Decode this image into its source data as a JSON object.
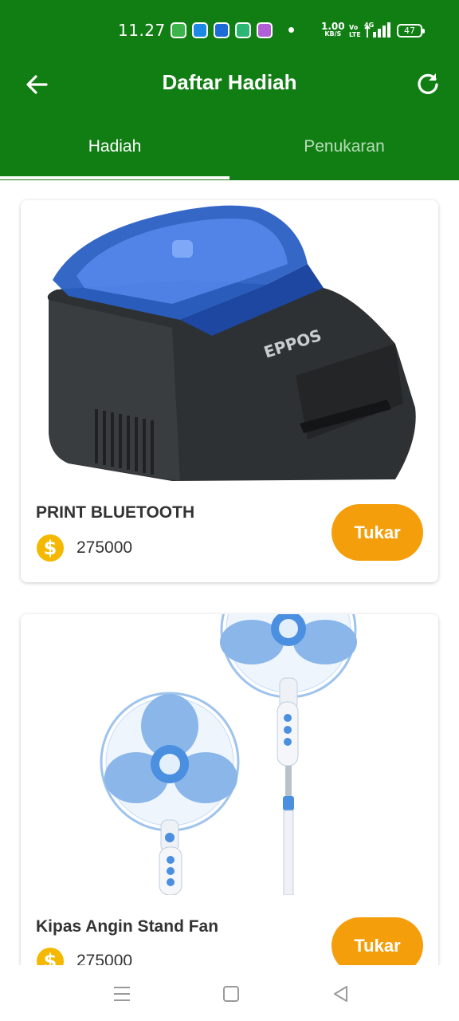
{
  "status_bar": {
    "time": "11.27",
    "net_speed_value": "1.00",
    "net_speed_unit": "KB/S",
    "volte_label": "Vo LTE",
    "network_type": "4G",
    "battery": "47"
  },
  "app_bar": {
    "title": "Daftar Hadiah",
    "back_icon": "arrow-left-icon",
    "refresh_icon": "refresh-icon"
  },
  "tabs": [
    {
      "label": "Hadiah",
      "active": true
    },
    {
      "label": "Penukaran",
      "active": false
    }
  ],
  "items": [
    {
      "name": "PRINT BLUETOOTH",
      "points": "275000",
      "button_label": "Tukar",
      "image": "thermal-printer-image",
      "brand_label": "EPPOS"
    },
    {
      "name": "Kipas Angin Stand Fan",
      "points": "275000",
      "button_label": "Tukar",
      "image": "stand-fan-image"
    }
  ],
  "colors": {
    "primary": "#117e14",
    "accent": "#f59e0b",
    "coin": "#f5b800"
  },
  "nav_bar": [
    "menu-icon",
    "home-icon",
    "back-triangle-icon"
  ]
}
